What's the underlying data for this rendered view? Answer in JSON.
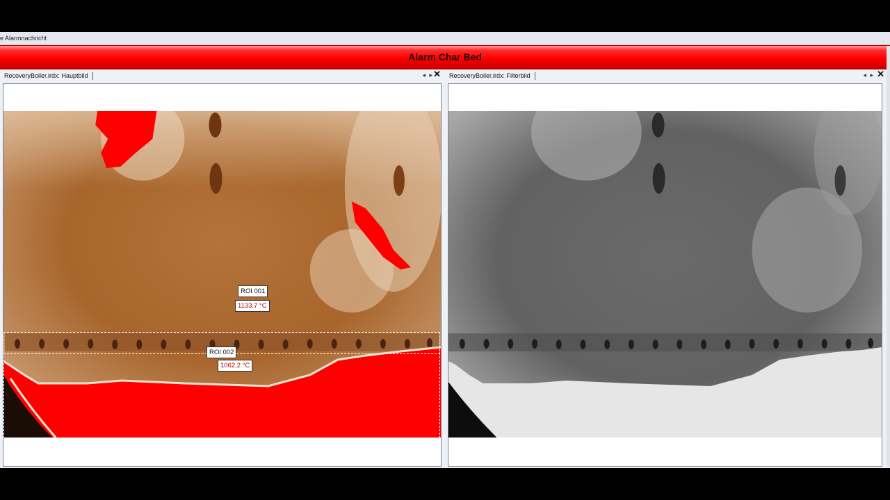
{
  "menu": {
    "label": "lle Alarmnachricht"
  },
  "alarm": {
    "title": "Alarm Char Bed"
  },
  "panels": {
    "left": {
      "tab_label": "RecoveryBoiler.irdx: Hauptbild"
    },
    "right": {
      "tab_label": "RecoveryBoiler.irdx: Filterbild"
    }
  },
  "tab_controls": {
    "prev": "◂",
    "next": "▸",
    "close": "✕"
  },
  "rois": [
    {
      "name": "ROI 001",
      "temp": "1133,7 °C"
    },
    {
      "name": "ROI 002",
      "temp": "1062,2 °C"
    }
  ],
  "colors": {
    "alarm": "#ff0000",
    "palette_warm": "#a5632c",
    "palette_gray": "#6b6b6b"
  }
}
